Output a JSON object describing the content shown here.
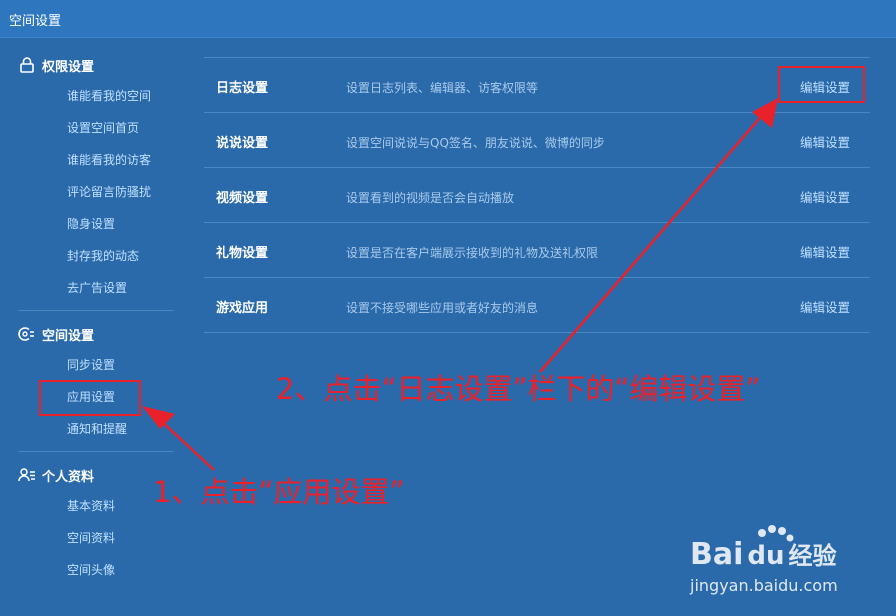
{
  "window": {
    "title": "空间设置"
  },
  "sidebar": {
    "groups": [
      {
        "label": "权限设置",
        "icon": "lock-icon",
        "items": [
          {
            "label": "谁能看我的空间"
          },
          {
            "label": "设置空间首页"
          },
          {
            "label": "谁能看我的访客"
          },
          {
            "label": "评论留言防骚扰"
          },
          {
            "label": "隐身设置"
          },
          {
            "label": "封存我的动态"
          },
          {
            "label": "去广告设置"
          }
        ]
      },
      {
        "label": "空间设置",
        "icon": "gear-sync-icon",
        "items": [
          {
            "label": "同步设置"
          },
          {
            "label": "应用设置"
          },
          {
            "label": "通知和提醒"
          }
        ]
      },
      {
        "label": "个人资料",
        "icon": "user-list-icon",
        "items": [
          {
            "label": "基本资料"
          },
          {
            "label": "空间资料"
          },
          {
            "label": "空间头像"
          }
        ]
      }
    ]
  },
  "settings_rows": [
    {
      "name": "日志设置",
      "desc": "设置日志列表、编辑器、访客权限等",
      "action": "编辑设置"
    },
    {
      "name": "说说设置",
      "desc": "设置空间说说与QQ签名、朋友说说、微博的同步",
      "action": "编辑设置"
    },
    {
      "name": "视频设置",
      "desc": "设置看到的视频是否会自动播放",
      "action": "编辑设置"
    },
    {
      "name": "礼物设置",
      "desc": "设置是否在客户端展示接收到的礼物及送礼权限",
      "action": "编辑设置"
    },
    {
      "name": "游戏应用",
      "desc": "设置不接受哪些应用或者好友的消息",
      "action": "编辑设置"
    }
  ],
  "annotations": {
    "step1": "1、点击“应用设置”",
    "step2": "2、点击“日志设置”栏下的“编辑设置”"
  },
  "watermark": {
    "brand_left": "Bai",
    "brand_mid": "du",
    "brand_right": "经验",
    "url": "jingyan.baidu.com"
  },
  "colors": {
    "background": "#2a6aab",
    "titlebar": "#2e76bd",
    "link": "#bfe0ff",
    "annotation": "#e8212a"
  }
}
